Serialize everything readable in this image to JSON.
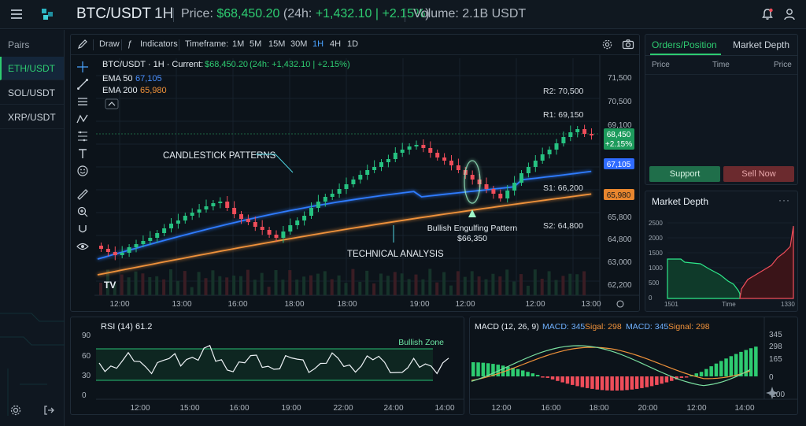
{
  "header": {
    "symbol": "BTC/USDT",
    "timeframe": "1H",
    "price_label": "Price:",
    "price": "$68,450.20",
    "change_prefix": "(24h:",
    "change_value": "+1,432.10 | +2.15%",
    "change_suffix": ")",
    "volume": "Volume: 2.1B USDT"
  },
  "sidebar": {
    "title": "Pairs",
    "items": [
      {
        "label": "ETH/USDT",
        "active": true
      },
      {
        "label": "SOL/USDT",
        "active": false
      },
      {
        "label": "XRP/USDT",
        "active": false
      }
    ]
  },
  "toolbar": {
    "draw": "Draw",
    "indicators": "Indicators",
    "timeframe_label": "Timeframe:",
    "timeframes": [
      "1M",
      "5M",
      "15M",
      "30M",
      "1H",
      "4H",
      "1D"
    ],
    "active_timeframe": "1H"
  },
  "chart": {
    "legend_symbol": "BTC/USDT · 1H · Current:",
    "legend_price": "$68,450.20",
    "legend_change": "(24h: +1,432.10 | +2.15%)",
    "ema50_label": "EMA 50",
    "ema50_value": "67,105",
    "ema200_label": "EMA 200",
    "ema200_value": "65,980",
    "price_ticks": [
      "71,500",
      "70,500",
      "69,100",
      "68,450",
      "67,105",
      "65,980",
      "65,800",
      "64,800",
      "63,000",
      "62,200"
    ],
    "price_badge_top": "68,450",
    "price_badge_bottom": "+2.15%",
    "time_ticks": [
      "12:00",
      "13:00",
      "16:00",
      "18:00",
      "18:00",
      "19:00",
      "12:00",
      "12:00",
      "13:00"
    ],
    "levels": [
      {
        "label": "R2: 70,500",
        "color": "#ff5c6c"
      },
      {
        "label": "R1: 69,150",
        "color": "#ff6b7a"
      },
      {
        "label": "S1: 66,200",
        "color": "#3fd0ff"
      },
      {
        "label": "S2: 64,800",
        "color": "#2ee88a"
      }
    ],
    "annotation_patterns": "CANDLESTICK PATTERNS",
    "annotation_technical": "TECHNICAL ANALYSIS",
    "annotation_engulfing": "Bullish Engulfing Pattern",
    "annotation_engulfing_price": "$66,350",
    "watermark": "TV",
    "colors": {
      "up": "#26c281",
      "down": "#ef4d5a",
      "ema50": "#2f7bff",
      "ema200": "#f0923a"
    }
  },
  "orders": {
    "tab_active": "Orders/Position",
    "tab_other": "Market Depth",
    "columns": [
      "Price",
      "Time",
      "Price"
    ],
    "support_button": "Support",
    "sell_button": "Sell Now"
  },
  "depth": {
    "title": "Market Depth",
    "menu": "···",
    "y_ticks": [
      "2500",
      "2000",
      "1500",
      "1000",
      "500",
      "0"
    ],
    "x_left": "1501",
    "x_mid": "Time",
    "x_right": "1330"
  },
  "rsi": {
    "label": "RSI (14)",
    "value": "61.2",
    "zone_label": "Bullish Zone",
    "y_ticks": [
      "90",
      "60",
      "30",
      "0"
    ],
    "x_ticks": [
      "12:00",
      "15:00",
      "16:00",
      "19:00",
      "22:00",
      "24:00",
      "14:00"
    ]
  },
  "macd": {
    "label": "MACD (12, 26, 9)",
    "macd1": "MACD: 345",
    "signal1": "Sigal: 298",
    "macd2": "MACD: 345",
    "signal2": "Signal: 298",
    "y_ticks": [
      "345",
      "298",
      "165",
      "0",
      "-100"
    ],
    "x_ticks": [
      "12:00",
      "16:00",
      "18:00",
      "20:00",
      "12:00",
      "14:00"
    ]
  }
}
